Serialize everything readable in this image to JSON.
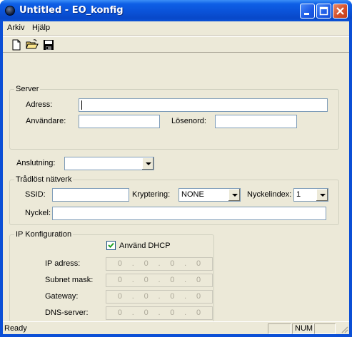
{
  "window": {
    "title": "Untitled - EO_konfig"
  },
  "menu": {
    "items": [
      "Arkiv",
      "Hjälp"
    ]
  },
  "toolbar": {
    "buttons": [
      "new-document-icon",
      "open-folder-icon",
      "save-disk-icon"
    ]
  },
  "server": {
    "legend": "Server",
    "address_label": "Adress:",
    "address_value": "",
    "user_label": "Användare:",
    "user_value": "",
    "password_label": "Lösenord:",
    "password_value": ""
  },
  "connection": {
    "label": "Anslutning:",
    "value": ""
  },
  "wireless": {
    "legend": "Trådlöst nätverk",
    "ssid_label": "SSID:",
    "ssid_value": "",
    "encryption_label": "Kryptering:",
    "encryption_value": "NONE",
    "keyindex_label": "Nyckelindex:",
    "keyindex_value": "1",
    "key_label": "Nyckel:",
    "key_value": ""
  },
  "ip": {
    "legend": "IP Konfiguration",
    "dhcp_label": "Använd DHCP",
    "dhcp_checked": true,
    "ip_label": "IP adress:",
    "subnet_label": "Subnet mask:",
    "gateway_label": "Gateway:",
    "dns_label": "DNS-server:",
    "octet": "0",
    "dot": "."
  },
  "status": {
    "text": "Ready",
    "num": "NUM"
  }
}
